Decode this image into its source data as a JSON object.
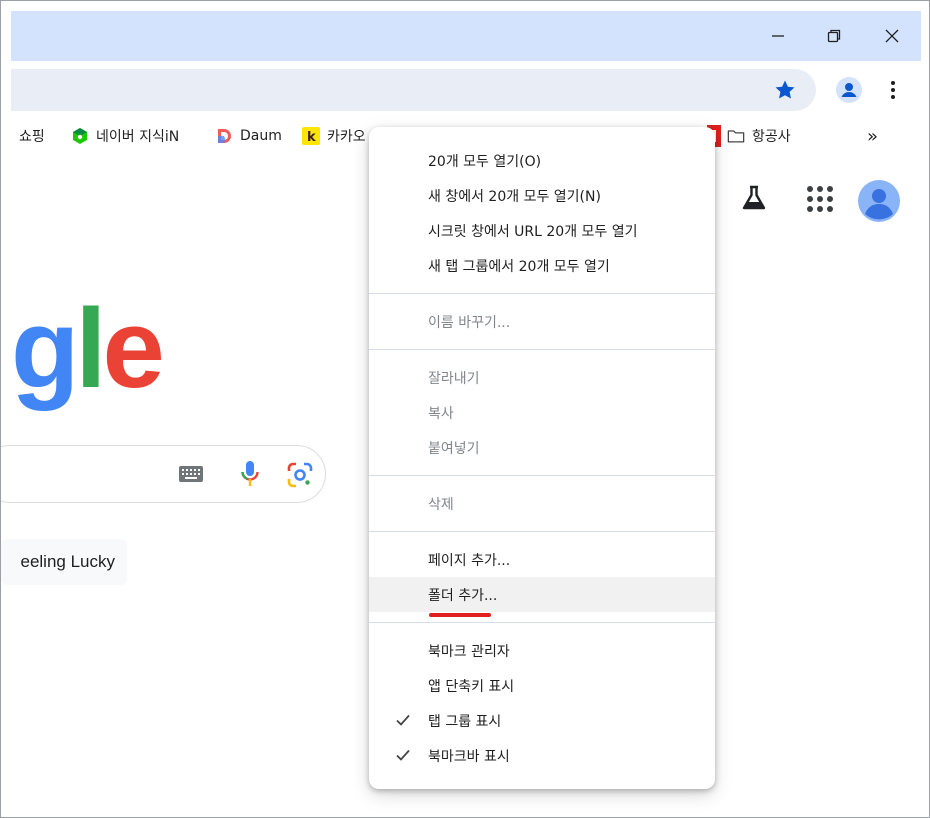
{
  "window": {
    "minimize_glyph": "—",
    "maximize_glyph": "❐",
    "close_glyph": "✕"
  },
  "bookmarks": [
    {
      "label": "쇼핑",
      "icon": "shopping-icon"
    },
    {
      "label": "네이버 지식iN",
      "icon": "naver-kin-icon"
    },
    {
      "label": "Daum",
      "icon": "daum-icon"
    },
    {
      "label": "카카오",
      "icon": "kakao-icon"
    },
    {
      "label": "항공사",
      "icon": "folder-icon"
    }
  ],
  "bookmark_overflow": "»",
  "page": {
    "logo_letters": [
      "g",
      "l",
      "e"
    ],
    "logo_colors": [
      "#4285f4",
      "#34a853",
      "#ea4335"
    ],
    "lucky_label": "eeling Lucky"
  },
  "menu": {
    "groups": [
      [
        {
          "label": "20개 모두 열기(O)",
          "disabled": false
        },
        {
          "label": "새 창에서 20개 모두 열기(N)",
          "disabled": false
        },
        {
          "label": "시크릿 창에서 URL 20개 모두 열기",
          "disabled": false
        },
        {
          "label": "새 탭 그룹에서 20개 모두 열기",
          "disabled": false
        }
      ],
      [
        {
          "label": "이름 바꾸기...",
          "disabled": true
        }
      ],
      [
        {
          "label": "잘라내기",
          "disabled": true
        },
        {
          "label": "복사",
          "disabled": true
        },
        {
          "label": "붙여넣기",
          "disabled": true
        }
      ],
      [
        {
          "label": "삭제",
          "disabled": true
        }
      ],
      [
        {
          "label": "페이지 추가...",
          "disabled": false
        },
        {
          "label": "폴더 추가...",
          "disabled": false,
          "highlighted": true
        }
      ],
      [
        {
          "label": "북마크 관리자",
          "disabled": false
        },
        {
          "label": "앱 단축키 표시",
          "disabled": false
        },
        {
          "label": "탭 그룹 표시",
          "disabled": false,
          "checked": true
        },
        {
          "label": "북마크바 표시",
          "disabled": false,
          "checked": true
        }
      ]
    ]
  },
  "colors": {
    "accent": "#0b57d0",
    "titlebar": "#d3e3fd",
    "omnibox": "#e9eef6",
    "annotation": "#e0201f"
  }
}
